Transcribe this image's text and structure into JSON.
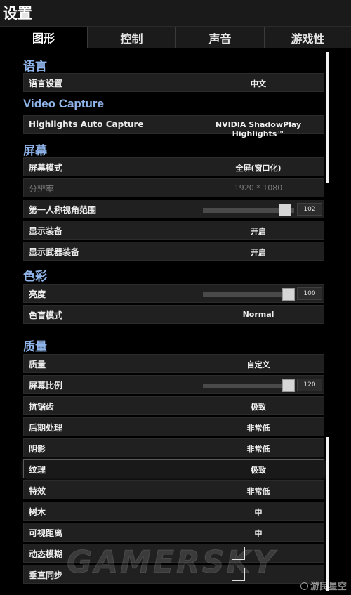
{
  "window": {
    "title": "设置"
  },
  "tabs": [
    {
      "label": "图形"
    },
    {
      "label": "控制"
    },
    {
      "label": "声音"
    },
    {
      "label": "游戏性"
    }
  ],
  "sections": {
    "language": {
      "heading": "语言",
      "rows": [
        {
          "label": "语言设置",
          "value": "中文"
        }
      ]
    },
    "video_capture": {
      "heading": "Video Capture",
      "rows": [
        {
          "label": "Highlights Auto Capture",
          "value": "NVIDIA ShadowPlay Highlights™"
        }
      ]
    },
    "screen": {
      "heading": "屏幕",
      "rows": [
        {
          "label": "屏幕模式",
          "value": "全屏(窗口化)"
        },
        {
          "label": "分辨率",
          "value": "1920 * 1080"
        },
        {
          "label": "第一人称视角范围",
          "value": "102",
          "level": 0.9
        },
        {
          "label": "显示装备",
          "value": "开启"
        },
        {
          "label": "显示武器装备",
          "value": "开启"
        }
      ]
    },
    "color": {
      "heading": "色彩",
      "rows": [
        {
          "label": "亮度",
          "value": "100",
          "level": 0.94
        },
        {
          "label": "色盲模式",
          "value": "Normal"
        }
      ]
    },
    "quality": {
      "heading": "质量",
      "rows": [
        {
          "label": "质量",
          "value": "自定义"
        },
        {
          "label": "屏幕比例",
          "value": "120",
          "level": 0.94
        },
        {
          "label": "抗锯齿",
          "value": "极致"
        },
        {
          "label": "后期处理",
          "value": "非常低"
        },
        {
          "label": "阴影",
          "value": "非常低"
        },
        {
          "label": "纹理",
          "value": "极致"
        },
        {
          "label": "特效",
          "value": "非常低"
        },
        {
          "label": "树木",
          "value": "中"
        },
        {
          "label": "可视距离",
          "value": "中"
        },
        {
          "label": "动态模糊",
          "checked": false
        },
        {
          "label": "垂直同步",
          "checked": false
        }
      ]
    }
  },
  "watermark": "GAMERSKY",
  "brand": "游民星空",
  "colors": {
    "section_heading": "#8fb5ea",
    "row_bg": "#202020",
    "accent_thumb": "#d6d6d6"
  },
  "icons": {
    "checkbox": "checkbox-empty-icon",
    "scroll": "scrollbar"
  }
}
